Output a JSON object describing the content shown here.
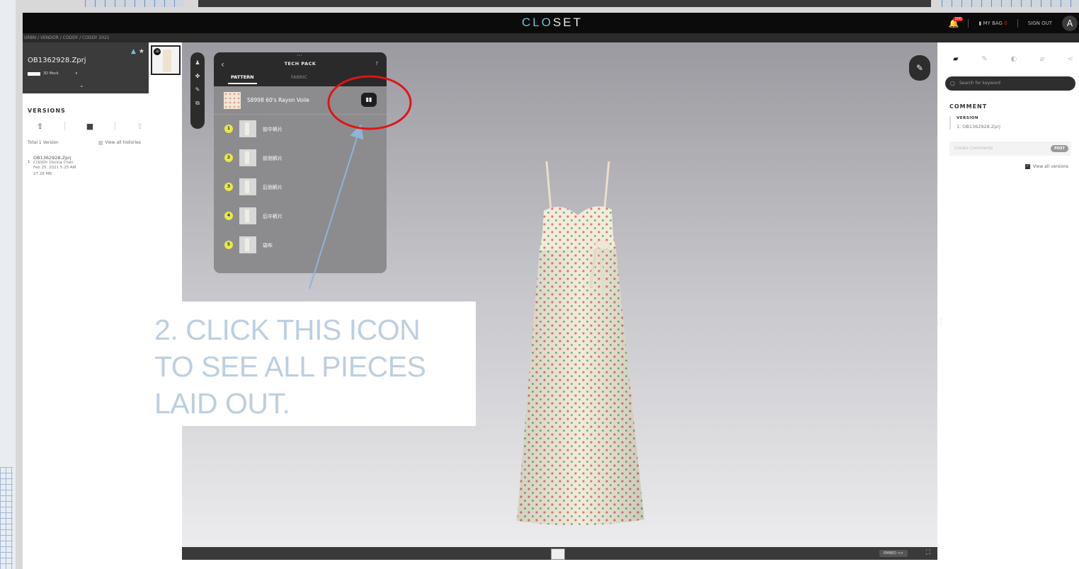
{
  "app": {
    "logo_prefix": "CLO",
    "logo_suffix": "SET",
    "breadcrumb": "URBN / VENDOR / CODDY / CODDY 2021"
  },
  "topbar": {
    "notification_count": "100",
    "bag_label": "MY BAG",
    "bag_count": "0",
    "sign_out": "SIGN OUT",
    "avatar_letter": "A"
  },
  "left_panel": {
    "file_name": "OB1362928.Zprj",
    "mode": "3D Mock",
    "versions_title": "VERSIONS",
    "total": "Total 1 Version",
    "view_all_histories": "View all histories",
    "version_item": {
      "number": "1",
      "name": "OB1362928.Zprj",
      "author": "CODDY- Donna Chen",
      "date": "Feb 25, 2021 5:25 AM",
      "size": "27.26 MB"
    }
  },
  "thumbnail": {
    "badge": "3D"
  },
  "tech_pack": {
    "title": "TECH PACK",
    "help": "?",
    "tabs": [
      "PATTERN",
      "FABRIC"
    ],
    "fabric_name": "S8998 60's Rayon Voile",
    "pieces": [
      {
        "num": "1",
        "name": "前中裤片"
      },
      {
        "num": "2",
        "name": "前侧裤片"
      },
      {
        "num": "3",
        "name": "后侧裤片"
      },
      {
        "num": "4",
        "name": "后中裤片"
      },
      {
        "num": "5",
        "name": "袋布"
      }
    ]
  },
  "viewer_bottom": {
    "embed_label": "EMBED <>"
  },
  "right_panel": {
    "search_placeholder": "Search for keyword",
    "comment_title": "COMMENT",
    "version_label": "VERSION",
    "version_value": "1. OB1362928.Zprj",
    "comment_placeholder": "Create Comments",
    "post": "POST",
    "view_all_versions": "View all versions"
  },
  "annotation": {
    "line1": "2. CLICK THIS ICON",
    "line2": "TO SEE ALL PIECES",
    "line3": "LAID OUT."
  },
  "colors": {
    "highlight_circle": "#e01414",
    "arrow": "#8fb4d6",
    "annotation_text": "#bccfe0",
    "accent": "#6ec1d6"
  }
}
